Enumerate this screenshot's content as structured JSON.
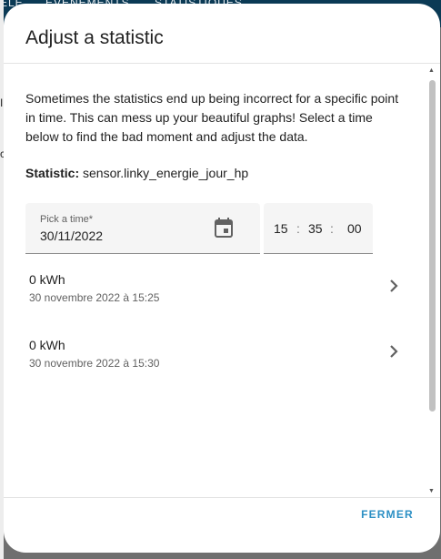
{
  "background": {
    "tabs": [
      "ELE",
      "ÉVÉNEMENTS",
      "STATISTIQUES"
    ],
    "marks": [
      "I",
      "c"
    ]
  },
  "dialog": {
    "title": "Adjust a statistic",
    "intro": "Sometimes the statistics end up being incorrect for a specific point in time. This can mess up your beautiful graphs! Select a time below to find the bad moment and adjust the data.",
    "statistic_label": "Statistic:",
    "statistic_id": "sensor.linky_energie_jour_hp",
    "date_field": {
      "label": "Pick a time*",
      "value": "30/11/2022",
      "icon": "calendar-icon"
    },
    "time_field": {
      "hours": "15",
      "minutes": "35",
      "seconds": "00",
      "separator": ":"
    },
    "entries": [
      {
        "value": "0 kWh",
        "date": "30 novembre 2022 à 15:25",
        "icon": "chevron-right-icon"
      },
      {
        "value": "0 kWh",
        "date": "30 novembre 2022 à 15:30",
        "icon": "chevron-right-icon"
      }
    ],
    "close_label": "FERMER"
  },
  "colors": {
    "accent": "#2b8fc4",
    "header_bg": "#0b3a55",
    "field_bg": "#f5f5f5",
    "text_primary": "#212121",
    "text_secondary": "#616161"
  }
}
